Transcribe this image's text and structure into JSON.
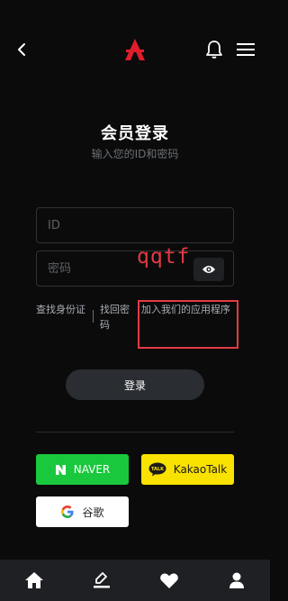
{
  "header": {
    "back_icon": "chevron-left-icon",
    "logo_icon": "red-a-logo",
    "bell_icon": "bell-icon",
    "menu_icon": "hamburger-menu-icon"
  },
  "login": {
    "title": "会员登录",
    "subtitle": "输入您的ID和密码",
    "id_placeholder": "ID",
    "password_placeholder": "密码",
    "watermark": "qqtf"
  },
  "links": {
    "find_id": "查找身份证",
    "find_password": "找回密码",
    "join_app": "加入我们的应用程序"
  },
  "buttons": {
    "login": "登录"
  },
  "social": {
    "naver": "NAVER",
    "kakao": "KakaoTalk",
    "kakao_badge": "TALK",
    "google": "谷歌"
  },
  "colors": {
    "background": "#0b0b0b",
    "naver": "#19c83c",
    "kakao": "#f9e100",
    "accent_red": "#e23a44"
  },
  "bottom_nav": [
    {
      "icon": "home-icon"
    },
    {
      "icon": "edit-icon"
    },
    {
      "icon": "heart-icon"
    },
    {
      "icon": "user-icon"
    }
  ]
}
